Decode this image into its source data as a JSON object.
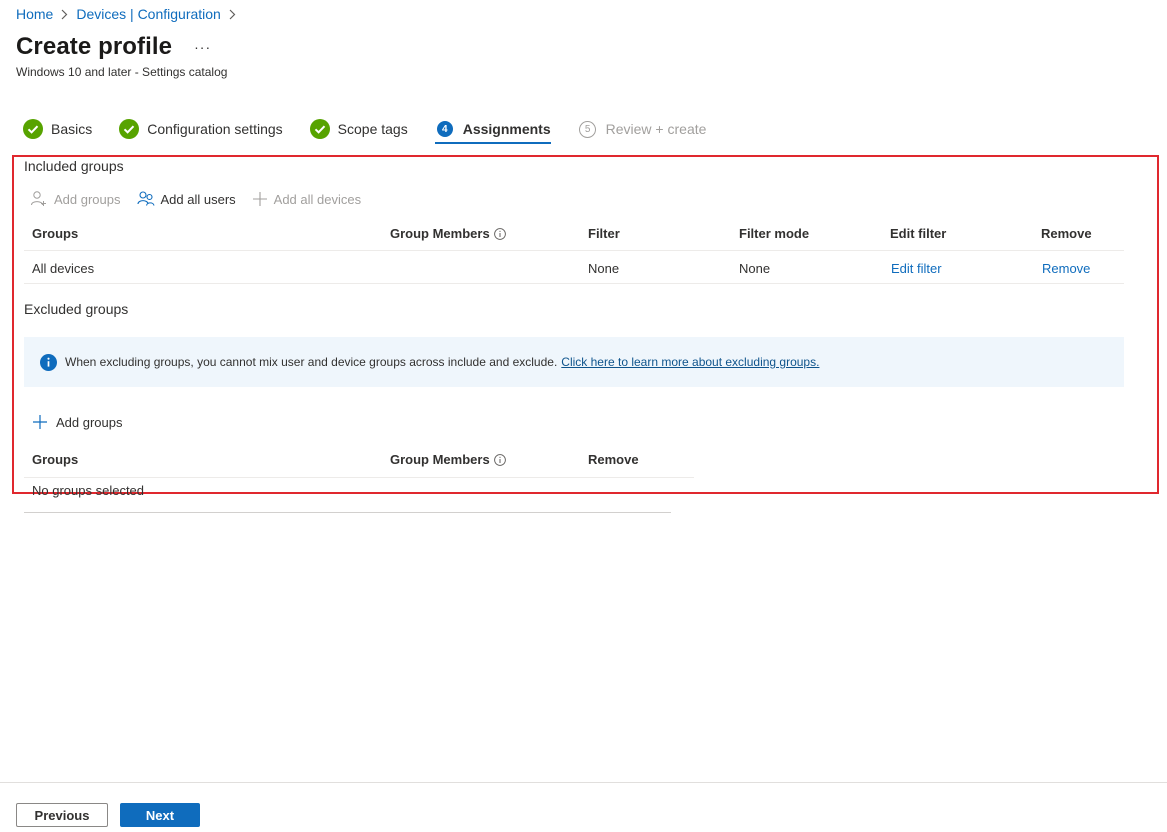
{
  "breadcrumb": {
    "home": "Home",
    "devices": "Devices | Configuration"
  },
  "header": {
    "title": "Create profile",
    "more": "···",
    "subtitle": "Windows 10 and later - Settings catalog"
  },
  "steps": [
    {
      "label": "Basics",
      "state": "done"
    },
    {
      "label": "Configuration settings",
      "state": "done"
    },
    {
      "label": "Scope tags",
      "state": "done"
    },
    {
      "label": "Assignments",
      "state": "active",
      "number": "4"
    },
    {
      "label": "Review + create",
      "state": "disabled",
      "number": "5"
    }
  ],
  "included": {
    "title": "Included groups",
    "toolbar": {
      "add_groups": "Add groups",
      "add_all_users": "Add all users",
      "add_all_devices": "Add all devices"
    },
    "columns": {
      "groups": "Groups",
      "group_members": "Group Members",
      "filter": "Filter",
      "filter_mode": "Filter mode",
      "edit_filter": "Edit filter",
      "remove": "Remove"
    },
    "rows": [
      {
        "groups": "All devices",
        "group_members": "",
        "filter": "None",
        "filter_mode": "None",
        "edit_filter": "Edit filter",
        "remove": "Remove"
      }
    ]
  },
  "excluded": {
    "title": "Excluded groups",
    "info_text": "When excluding groups, you cannot mix user and device groups across include and exclude.",
    "info_link": "Click here to learn more about excluding groups.",
    "add_groups": "Add groups",
    "columns": {
      "groups": "Groups",
      "group_members": "Group Members",
      "remove": "Remove"
    },
    "empty_text": "No groups selected"
  },
  "footer": {
    "previous": "Previous",
    "next": "Next"
  },
  "colors": {
    "accent": "#0f6cbd",
    "success": "#57a300",
    "highlight_border": "#e0282e",
    "info_bg": "#eff6fc"
  }
}
